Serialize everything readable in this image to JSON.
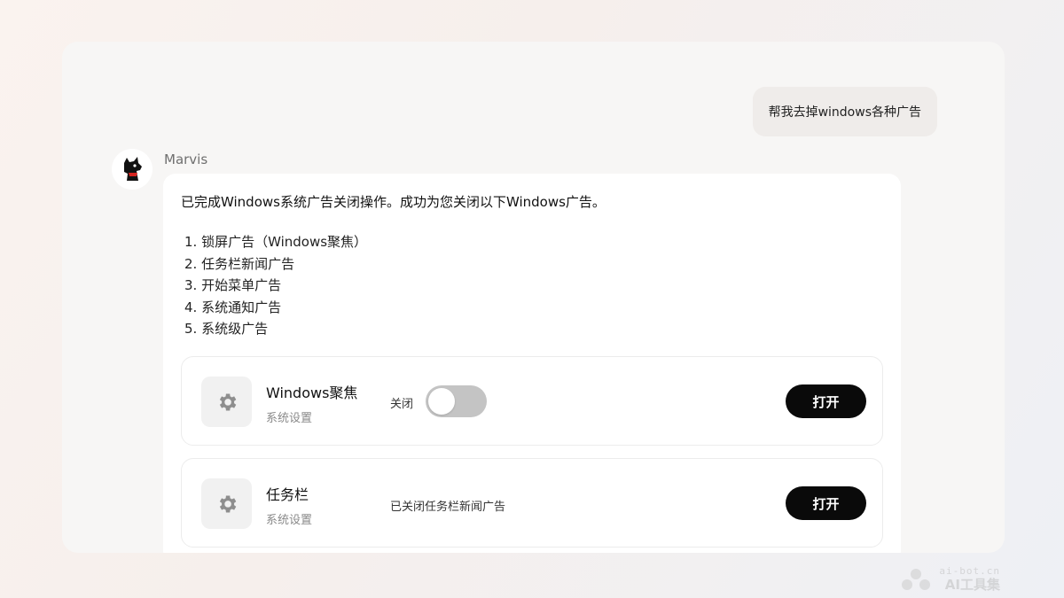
{
  "conversation": {
    "user_message": "帮我去掉windows各种广告",
    "bot_name": "Marvis",
    "reply_lead": "已完成Windows系统广告关闭操作。成功为您关闭以下Windows广告。",
    "list_items": [
      "1. 锁屏广告（Windows聚焦）",
      "2. 任务栏新闻广告",
      "3. 开始菜单广告",
      "4. 系统通知广告",
      "5. 系统级广告"
    ]
  },
  "cards": [
    {
      "title": "Windows聚焦",
      "subtitle": "系统设置",
      "state_label": "关闭",
      "toggle_on": false,
      "button_label": "打开",
      "icon": "gear-icon"
    },
    {
      "title": "任务栏",
      "subtitle": "系统设置",
      "note": "已关闭任务栏新闻广告",
      "button_label": "打开",
      "icon": "gear-icon"
    }
  ],
  "watermark": {
    "domain_text": "ai-bot.cn",
    "brand_text": "AI工具集"
  },
  "colors": {
    "button_bg": "#0a0a0a",
    "toggle_off": "#c4c4c4",
    "user_bubble": "#efecea"
  }
}
